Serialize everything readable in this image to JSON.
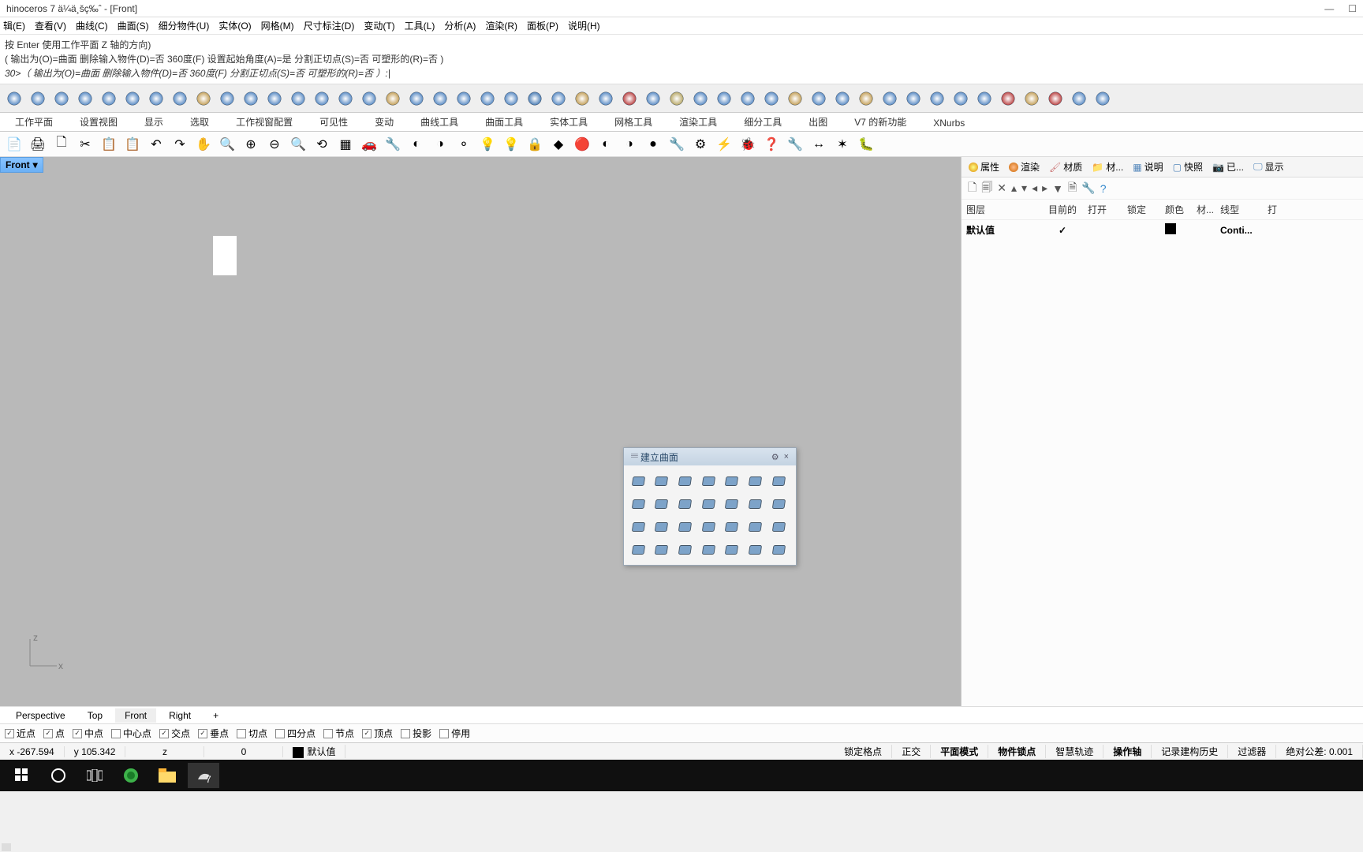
{
  "title": "hinoceros 7 ä¼ä¸šç‰ˆ - [Front]",
  "window_controls": {
    "min": "—",
    "max": "☐"
  },
  "menu": [
    "辑(E)",
    "查看(V)",
    "曲线(C)",
    "曲面(S)",
    "细分物件(U)",
    "实体(O)",
    "网格(M)",
    "尺寸标注(D)",
    "变动(T)",
    "工具(L)",
    "分析(A)",
    "渲染(R)",
    "面板(P)",
    "说明(H)"
  ],
  "command_lines": [
    "按 Enter 使用工作平面 Z 轴的方向)",
    "( 输出为(O)=曲面   删除输入物件(D)=否   360度(F)   设置起始角度(A)=是   分割正切点(S)=否   可塑形的(R)=否 )",
    "30>（ 输出为(O)=曲面   删除输入物件(D)=否   360度(F)   分割正切点(S)=否   可塑形的(R)=否 ）:|"
  ],
  "tabs": [
    "工作平面",
    "设置视图",
    "显示",
    "选取",
    "工作视窗配置",
    "可见性",
    "变动",
    "曲线工具",
    "曲面工具",
    "实体工具",
    "网格工具",
    "渲染工具",
    "细分工具",
    "出图",
    "V7 的新功能",
    "XNurbs"
  ],
  "viewport_label": "Front",
  "axis": {
    "z": "z",
    "x": "x"
  },
  "floating_panel": {
    "title": "建立曲面",
    "grip": "𝄘",
    "gear": "⚙",
    "close": "×"
  },
  "right_panel": {
    "tabs": [
      "属性",
      "渲染",
      "材质",
      "材...",
      "说明",
      "快照",
      "已...",
      "显示"
    ],
    "layer_header": [
      "图层",
      "目前的",
      "打开",
      "锁定",
      "颜色",
      "材...",
      "线型",
      "打"
    ],
    "default_layer": "默认值",
    "line_type": "Conti..."
  },
  "view_tabs": [
    "Perspective",
    "Top",
    "Front",
    "Right",
    "+"
  ],
  "osnap": {
    "items": [
      {
        "label": "近点",
        "checked": true
      },
      {
        "label": "点",
        "checked": true
      },
      {
        "label": "中点",
        "checked": true
      },
      {
        "label": "中心点",
        "checked": false
      },
      {
        "label": "交点",
        "checked": true
      },
      {
        "label": "垂点",
        "checked": true
      },
      {
        "label": "切点",
        "checked": false
      },
      {
        "label": "四分点",
        "checked": false
      },
      {
        "label": "节点",
        "checked": false
      },
      {
        "label": "顶点",
        "checked": true
      },
      {
        "label": "投影",
        "checked": false
      },
      {
        "label": "停用",
        "checked": false
      }
    ]
  },
  "status": {
    "x_label": "x",
    "x": "-267.594",
    "y_label": "y",
    "y": "105.342",
    "z_label": "z",
    "z_val": "0",
    "layer": "默认值",
    "items": [
      "锁定格点",
      "正交",
      "平面模式",
      "物件锁点",
      "智慧轨迹",
      "操作轴",
      "记录建构历史",
      "过滤器"
    ],
    "bold_items": [
      "平面模式",
      "物件锁点",
      "操作轴"
    ],
    "tol": "绝对公差: 0.001"
  }
}
